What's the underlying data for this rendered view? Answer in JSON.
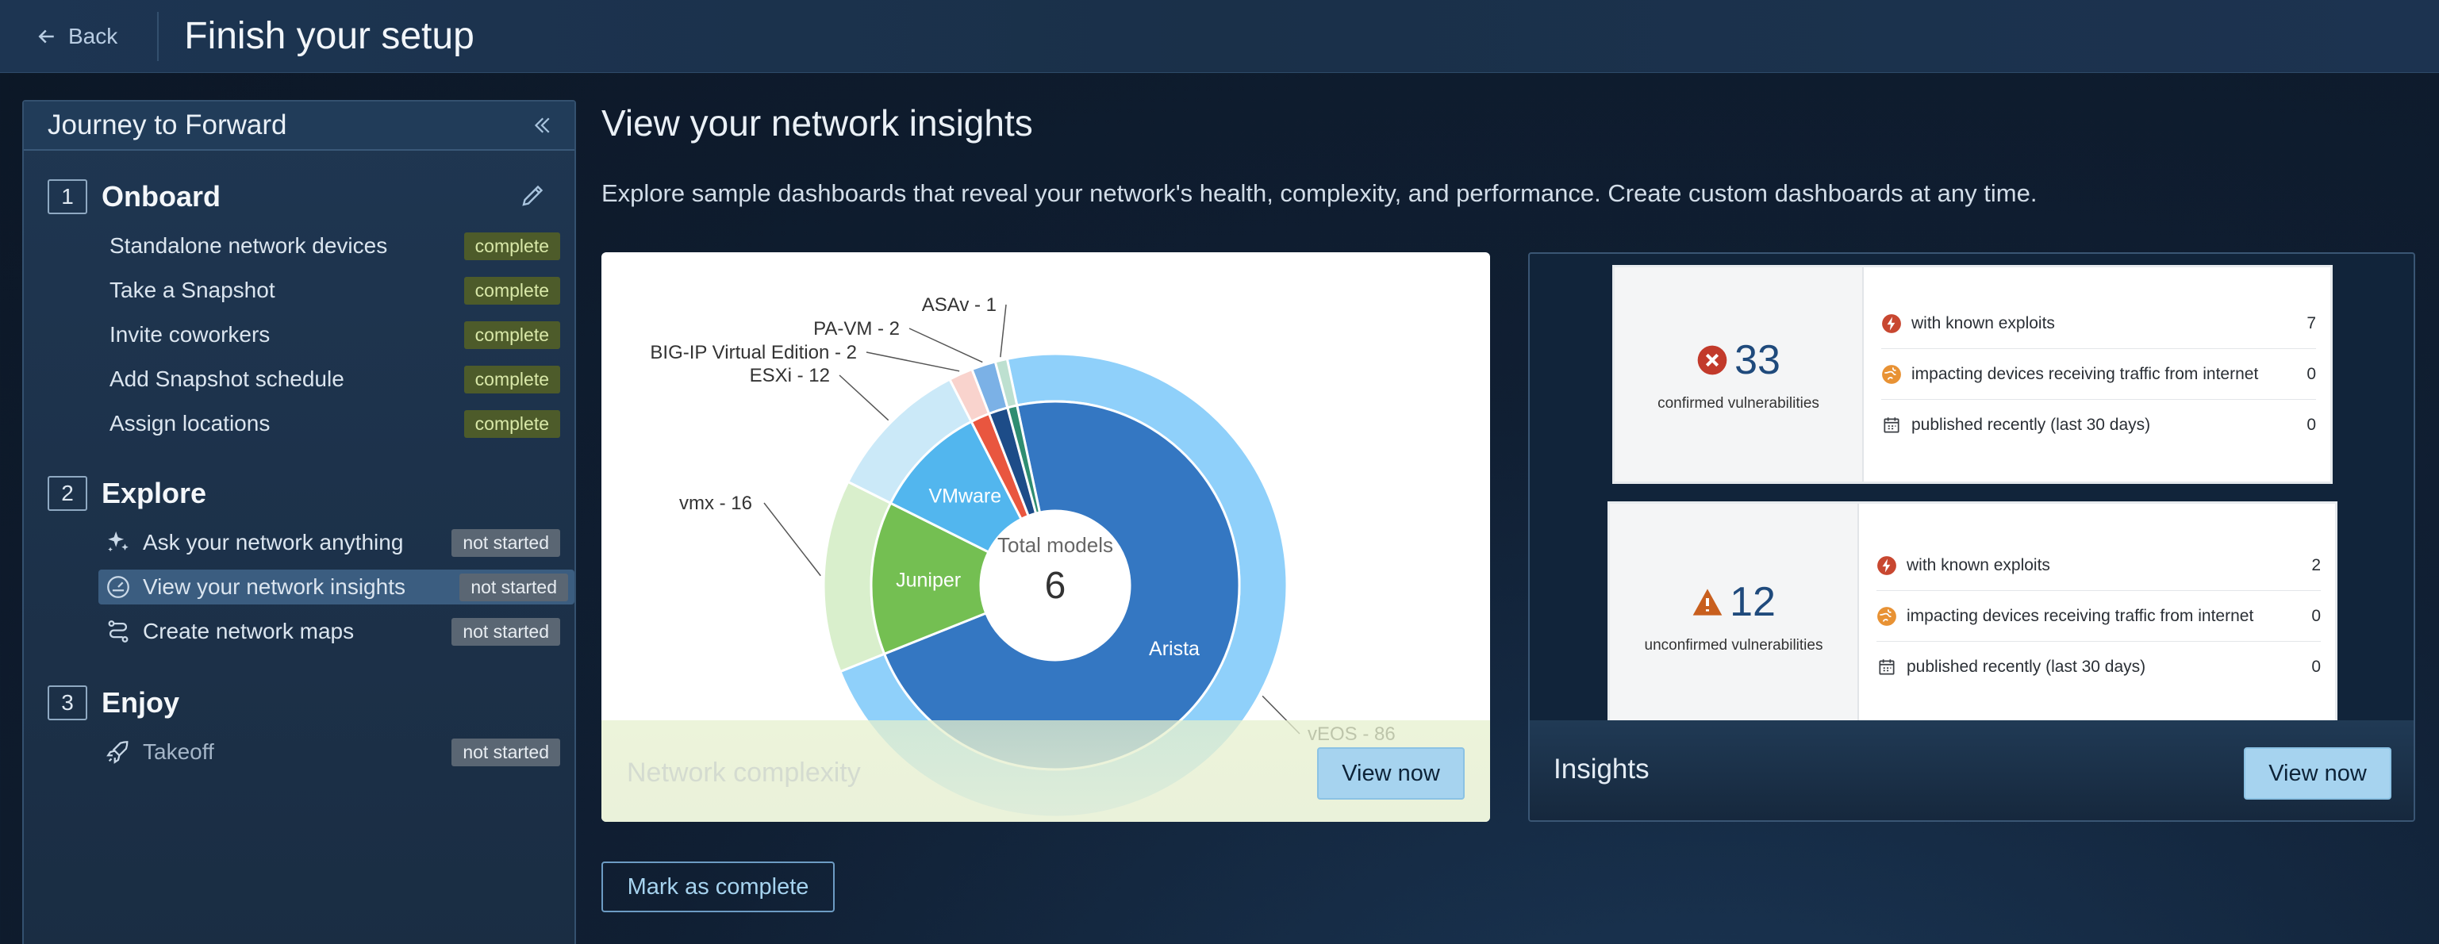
{
  "header": {
    "back_label": "Back",
    "title": "Finish your setup"
  },
  "sidebar": {
    "title": "Journey to Forward",
    "steps": [
      {
        "num": "1",
        "title": "Onboard",
        "tasks": [
          {
            "label": "Standalone network devices",
            "status": "complete"
          },
          {
            "label": "Take a Snapshot",
            "status": "complete"
          },
          {
            "label": "Invite coworkers",
            "status": "complete"
          },
          {
            "label": "Add Snapshot schedule",
            "status": "complete"
          },
          {
            "label": "Assign locations",
            "status": "complete"
          }
        ]
      },
      {
        "num": "2",
        "title": "Explore",
        "tasks": [
          {
            "label": "Ask your network anything",
            "status": "not started",
            "icon": "sparkle-icon"
          },
          {
            "label": "View your network insights",
            "status": "not started",
            "icon": "gauge-icon",
            "selected": true
          },
          {
            "label": "Create network maps",
            "status": "not started",
            "icon": "route-icon"
          }
        ]
      },
      {
        "num": "3",
        "title": "Enjoy",
        "tasks": [
          {
            "label": "Takeoff",
            "status": "not started",
            "icon": "rocket-icon"
          }
        ]
      }
    ]
  },
  "main": {
    "title": "View your network insights",
    "description": "Explore sample dashboards that reveal your network's health, complexity, and performance. Create custom dashboards at any time.",
    "complexity_card": {
      "label": "Network complexity",
      "button": "View now"
    },
    "insights_card": {
      "label": "Insights",
      "button": "View now",
      "confirmed": {
        "count": "33",
        "label": "confirmed vulnerabilities",
        "rows": [
          {
            "label": "with known exploits",
            "value": "7",
            "icon": "bolt-icon"
          },
          {
            "label": "impacting devices receiving traffic from internet",
            "value": "0",
            "icon": "globe-icon"
          },
          {
            "label": "published recently (last 30 days)",
            "value": "0",
            "icon": "calendar-icon"
          }
        ]
      },
      "unconfirmed": {
        "count": "12",
        "label": "unconfirmed vulnerabilities",
        "rows": [
          {
            "label": "with known exploits",
            "value": "2",
            "icon": "bolt-icon"
          },
          {
            "label": "impacting devices receiving traffic from internet",
            "value": "0",
            "icon": "globe-icon"
          },
          {
            "label": "published recently (last 30 days)",
            "value": "0",
            "icon": "calendar-icon"
          }
        ]
      }
    },
    "mark_complete": "Mark as complete"
  },
  "chart_data": {
    "type": "pie",
    "center_label": "Total models",
    "center_value": "6",
    "inner": [
      {
        "name": "Arista",
        "value": 86,
        "color": "#3477c2"
      },
      {
        "name": "Juniper",
        "value": 16,
        "color": "#74bf52"
      },
      {
        "name": "VMware",
        "value": 12,
        "color": "#52b6ee"
      },
      {
        "name": "",
        "value": 2,
        "color": "#e9563f"
      },
      {
        "name": "",
        "value": 2,
        "color": "#1d4c88"
      },
      {
        "name": "",
        "value": 1,
        "color": "#2f8d71"
      }
    ],
    "outer": [
      {
        "name": "vEOS - 86",
        "value": 86,
        "color": "#8fd0fa"
      },
      {
        "name": "vmx - 16",
        "value": 16,
        "color": "#d9efcc"
      },
      {
        "name": "ESXi - 12",
        "value": 12,
        "color": "#cbe9f8"
      },
      {
        "name": "BIG-IP Virtual Edition - 2",
        "value": 2,
        "color": "#f9d3cd"
      },
      {
        "name": "PA-VM - 2",
        "value": 2,
        "color": "#7bb1e6"
      },
      {
        "name": "ASAv - 1",
        "value": 1,
        "color": "#bde0d0"
      }
    ]
  }
}
